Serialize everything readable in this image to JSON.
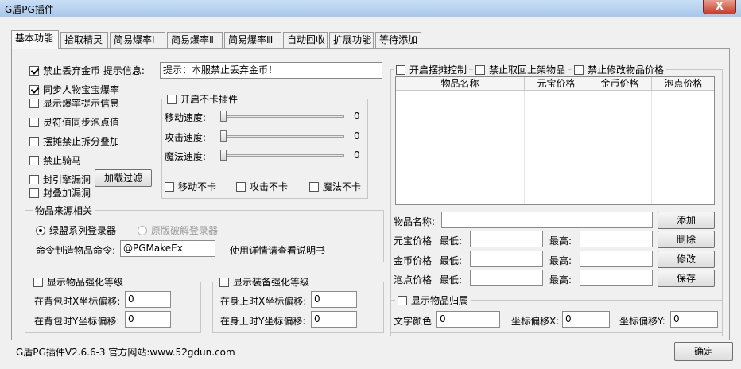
{
  "window": {
    "title": "G盾PG插件",
    "close_glyph": "X"
  },
  "tabs": [
    "基本功能",
    "拾取精灵",
    "简易爆率Ⅰ",
    "简易爆率Ⅱ",
    "简易爆率Ⅲ",
    "自动回收",
    "扩展功能",
    "等待添加"
  ],
  "basic": {
    "ban_drop_gold": {
      "label": "禁止丢弃金币 提示信息:",
      "checked": true
    },
    "tip_value": "提示：本服禁止丢弃金币！",
    "sync_drop": {
      "label": "同步人物宝宝爆率",
      "checked": true
    },
    "show_drop_tip": "显示爆率提示信息",
    "sync_bubble": "灵符值同步泡点值",
    "stall_ban_split": "摆摊禁止拆分叠加",
    "ban_ride": "禁止骑马",
    "seal_engine": "封引擎漏洞",
    "seal_stack": "封叠加漏洞",
    "load_filter": "加载过滤"
  },
  "nolag": {
    "title": "开启不卡插件",
    "move_speed": "移动速度:",
    "attack_speed": "攻击速度:",
    "magic_speed": "魔法速度:",
    "move_value": "0",
    "attack_value": "0",
    "magic_value": "0",
    "move_nolag": "移动不卡",
    "attack_nolag": "攻击不卡",
    "magic_nolag": "魔法不卡"
  },
  "source": {
    "title": "物品来源相关",
    "opt1": "绿盟系列登录器",
    "opt2": "原版破解登录器",
    "cmd_label": "命令制造物品命令:",
    "cmd_value": "@PGMakeEx",
    "cmd_hint": "使用详情请查看说明书"
  },
  "item_enhance": {
    "title": "显示物品强化等级",
    "x_label": "在背包时X坐标偏移:",
    "y_label": "在背包时Y坐标偏移:",
    "x_value": "0",
    "y_value": "0"
  },
  "equip_enhance": {
    "title": "显示装备强化等级",
    "x_label": "在身上时X坐标偏移:",
    "y_label": "在身上时Y坐标偏移:",
    "x_value": "0",
    "y_value": "0"
  },
  "stall": {
    "enable": "开启摆摊控制",
    "ban_take": "禁止取回上架物品",
    "ban_modify": "禁止修改物品价格",
    "columns": [
      "物品名称",
      "元宝价格",
      "金币价格",
      "泡点价格"
    ],
    "item_name_label": "物品名称:",
    "yuanbao_label": "元宝价格",
    "gold_label": "金币价格",
    "bubble_label": "泡点价格",
    "min_label": "最低:",
    "max_label": "最高:",
    "add": "添加",
    "delete": "删除",
    "modify": "修改",
    "save": "保存"
  },
  "belong": {
    "title": "显示物品归属",
    "text_color": "文字颜色",
    "text_color_value": "0",
    "x_label": "坐标偏移X:",
    "x_value": "0",
    "y_label": "坐标偏移Y:",
    "y_value": "0"
  },
  "footer": {
    "version": "G盾PG插件V2.6.6-3 官方网站:www.52gdun.com",
    "ok": "确定"
  }
}
